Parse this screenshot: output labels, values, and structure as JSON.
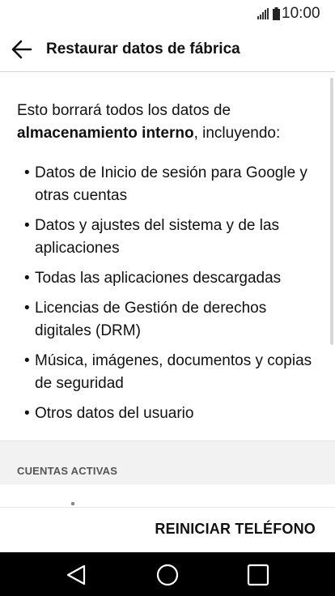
{
  "status_bar": {
    "time": "10:00",
    "icons": [
      "signal-icon",
      "battery-icon"
    ]
  },
  "header": {
    "back_icon": "arrow-left-icon",
    "title": "Restaurar datos de fábrica"
  },
  "content": {
    "intro_prefix": "Esto borrará todos los datos de ",
    "intro_bold": "almacenamiento interno",
    "intro_suffix": ", incluyendo:",
    "bullet": "•",
    "items": [
      "Datos de Inicio de sesión para Google y otras cuentas",
      "Datos y ajustes del sistema y de las aplicaciones",
      "Todas las aplicaciones descargadas",
      "Licencias de Gestión de derechos digitales (DRM)",
      "Música, imágenes, documentos y copias de seguridad",
      "Otros datos del usuario"
    ]
  },
  "section": {
    "header": "CUENTAS ACTIVAS"
  },
  "action": {
    "reset_label": "REINICIAR TELÉFONO"
  },
  "nav_bar": {
    "icons": [
      "nav-back-icon",
      "nav-home-icon",
      "nav-recent-apps-icon"
    ]
  },
  "colors": {
    "background": "#ffffff",
    "text": "#111111",
    "section_background": "#f2f2f2",
    "section_text": "#555555",
    "nav_background": "#000000",
    "nav_icon": "#ffffff"
  }
}
